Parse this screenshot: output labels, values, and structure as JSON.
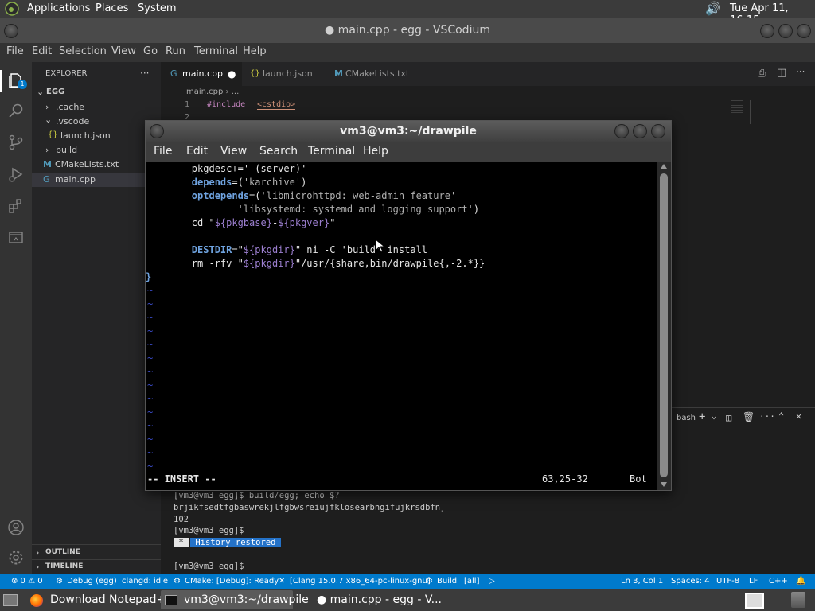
{
  "top_panel": {
    "applications": "Applications",
    "places": "Places",
    "system": "System",
    "datetime": "Tue Apr 11, 16:15"
  },
  "vscode": {
    "window_title": "● main.cpp - egg - VSCodium",
    "menu": [
      "File",
      "Edit",
      "Selection",
      "View",
      "Go",
      "Run",
      "Terminal",
      "Help"
    ],
    "explorer_label": "EXPLORER",
    "explorer_more": "···",
    "badge_count": "1",
    "tree": {
      "root": "EGG",
      "cache": ".cache",
      "vscode_folder": ".vscode",
      "launch": "launch.json",
      "build": "build",
      "cmakelists": "CMakeLists.txt",
      "main": "main.cpp"
    },
    "outline": "OUTLINE",
    "timeline": "TIMELINE",
    "tabs": [
      {
        "label": "main.cpp",
        "icon": "G"
      },
      {
        "label": "launch.json",
        "icon": "{}"
      },
      {
        "label": "CMakeLists.txt",
        "icon": "M"
      }
    ],
    "breadcrumb": "main.cpp › ...",
    "code_line_numbers": [
      "1",
      "2"
    ],
    "code_line_1_directive": "#include",
    "code_line_1_header": "<cstdio>",
    "terminal_shell": "bash",
    "terminal_lines": [
      "[vm3@vm3 egg]$ build/egg; echo $?",
      "brjikfsedtfgbaswrekjlfgbwsreiujfklosearbngifujkrsdbfn]",
      "102",
      "[vm3@vm3 egg]$"
    ],
    "history_star": " * ",
    "history_restored": " History restored ",
    "prompt_last": "[vm3@vm3 egg]$",
    "status": {
      "problems": "⊗ 0 ⚠ 0",
      "debug": "Debug (egg)",
      "clangd": "clangd: idle",
      "cmake": "CMake: [Debug]: Ready",
      "kit": "[Clang 15.0.7 x86_64-pc-linux-gnu]",
      "build": "Build",
      "all": "[all]",
      "position": "Ln 3, Col 1",
      "spaces": "Spaces: 4",
      "encoding": "UTF-8",
      "eol": "LF",
      "language": "C++"
    }
  },
  "gnome_terminal": {
    "title": "vm3@vm3:~/drawpile",
    "menu": [
      "File",
      "Edit",
      "View",
      "Search",
      "Terminal",
      "Help"
    ],
    "mode": "-- INSERT --",
    "cursor_pos": "63,25-32",
    "scroll_pos": "Bot"
  },
  "taskbar": {
    "items": [
      "Download Notepad+...",
      "vm3@vm3:~/drawpile",
      "● main.cpp - egg - V..."
    ]
  },
  "colors": {
    "statusbar": "#007acc",
    "history_bg": "#2472c8",
    "vim_keyword": "#6fa3e0",
    "vim_tilde": "#3a4bc8"
  }
}
